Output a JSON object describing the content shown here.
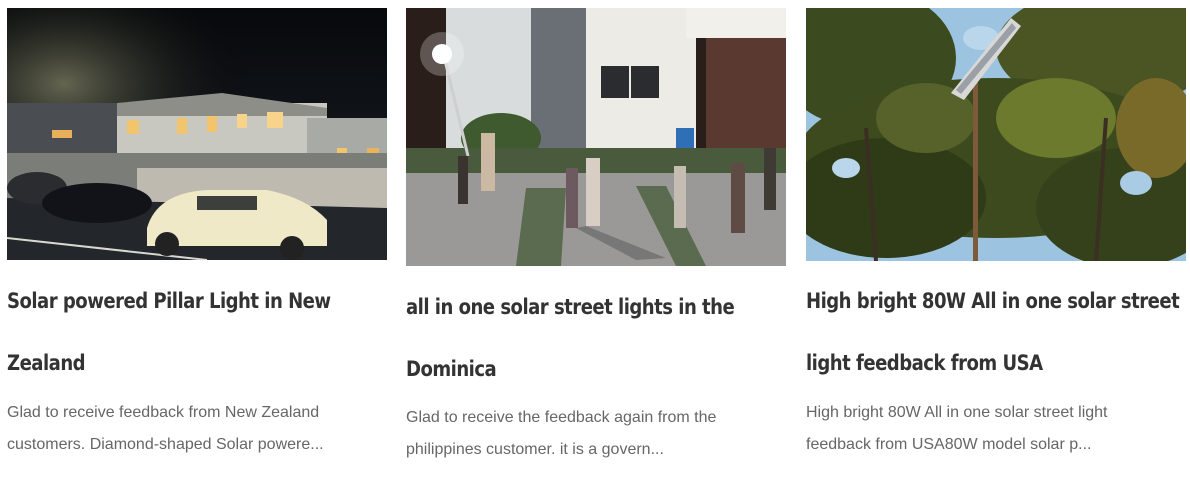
{
  "cards": [
    {
      "title": "Solar powered Pillar Light in New Zealand",
      "excerpt": "Glad to receive feedback from New Zealand customers. Diamond-shaped Solar powere...",
      "image": "night-street-houses-cars-photo"
    },
    {
      "title": "all in one solar street lights in the Dominica",
      "excerpt": "Glad to receive the feedback again from the philippines customer. it is a govern...",
      "image": "night-people-under-street-light-photo"
    },
    {
      "title": "High bright 80W All in one solar street light feedback from USA",
      "excerpt": "High bright 80W All in one solar street light feedback from USA80W model solar p...",
      "image": "solar-street-light-trees-sky-photo"
    }
  ]
}
